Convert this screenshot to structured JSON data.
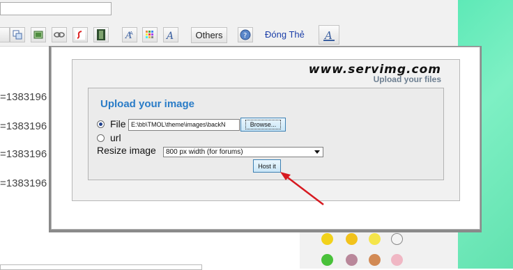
{
  "toolbar": {
    "others_label": "Others",
    "close_label": "Đóng Thẻ"
  },
  "editor": {
    "lines": [
      "=1383196",
      "=1383196",
      "=1383196",
      "=1383196"
    ]
  },
  "upload_dialog": {
    "logo_text": "www.servimg.com",
    "logo_tagline": "Upload your files",
    "title": "Upload your image",
    "file_label": "File",
    "file_value": "E:\\bb\\TMOL\\theme\\images\\backN",
    "browse_label": "Browse...",
    "url_label": "url",
    "resize_label": "Resize image",
    "resize_selected": "800 px width (for forums)",
    "host_label": "Host it",
    "source_selected": "file"
  },
  "colors": {
    "accent_title": "#2a7cc7",
    "arrow": "#d71920",
    "page_bg_strip": "#63e2b0"
  },
  "icons": [
    "image-icon",
    "image-gallery-icon",
    "link-icon",
    "flash-icon",
    "video-icon",
    "font-face-icon",
    "color-palette-icon",
    "font-style-icon",
    "help-icon",
    "remove-format-icon"
  ]
}
